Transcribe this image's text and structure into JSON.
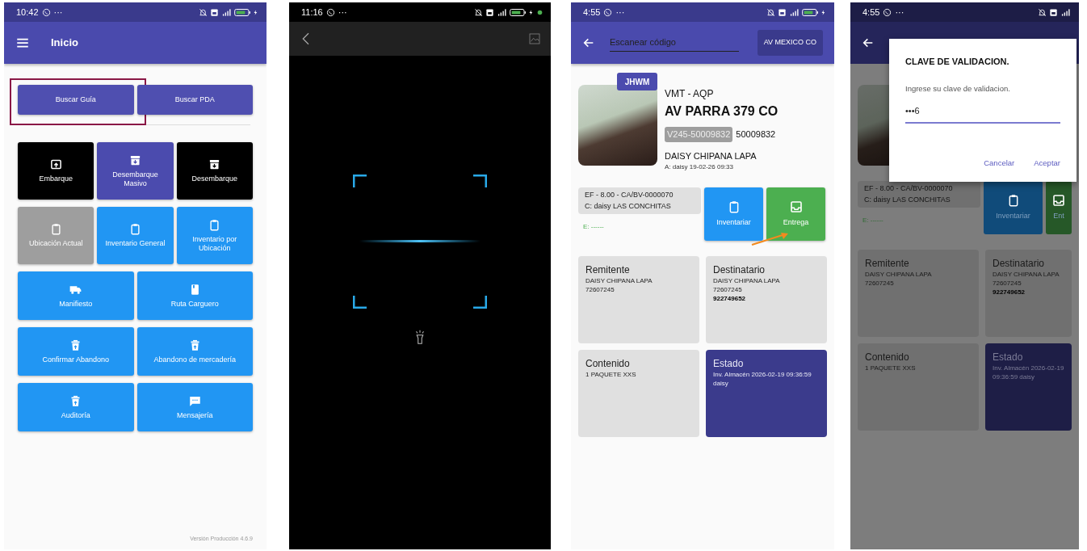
{
  "screens": [
    {
      "kind": "home",
      "status_bar": {
        "time": "10:42",
        "more": "···"
      },
      "app_bar": {
        "title": "Inicio"
      },
      "search_buttons": [
        {
          "label": "Buscar Guía",
          "highlighted": true
        },
        {
          "label": "Buscar PDA",
          "highlighted": false
        }
      ],
      "tile_rows": [
        {
          "tiles": [
            {
              "label": "Embarque",
              "kind": "tray-up",
              "color": "#000000"
            },
            {
              "label": "Desembarque Masivo",
              "kind": "box",
              "color": "#4b4bae"
            },
            {
              "label": "Desembarque",
              "kind": "box",
              "color": "#000000"
            }
          ]
        },
        {
          "tiles": [
            {
              "label": "Ubicación Actual",
              "kind": "clipboard",
              "color": "#9e9e9e"
            },
            {
              "label": "Inventario General",
              "kind": "clipboard",
              "color": "#2196f3"
            },
            {
              "label": "Inventario por Ubicación",
              "kind": "clipboard",
              "color": "#2196f3"
            }
          ]
        },
        {
          "tiles": [
            {
              "label": "Manifiesto",
              "kind": "truck",
              "color": "#2196f3"
            },
            {
              "label": "Ruta Carguero",
              "kind": "book",
              "color": "#2196f3"
            }
          ]
        },
        {
          "tiles": [
            {
              "label": "Confirmar Abandono",
              "kind": "trash",
              "color": "#2196f3"
            },
            {
              "label": "Abandono de mercadería",
              "kind": "trash",
              "color": "#2196f3"
            }
          ]
        },
        {
          "tiles": [
            {
              "label": "Auditoría",
              "kind": "trash",
              "color": "#2196f3"
            },
            {
              "label": "Mensajería",
              "kind": "chat",
              "color": "#2196f3"
            }
          ]
        }
      ],
      "version": "Versión Producción 4.6.9"
    },
    {
      "kind": "scanner",
      "status_bar": {
        "time": "11:16",
        "more": "···"
      }
    },
    {
      "kind": "detail",
      "status_bar": {
        "time": "4:55",
        "more": "···"
      },
      "header": {
        "search": {
          "placeholder": "Escanear código"
        },
        "branch_button": "AV MEXICO CO"
      },
      "detail": {
        "badge": "JHWM",
        "route": "VMT - AQP",
        "address": "AV PARRA 379 CO",
        "tracking_tag": "V245-50009832",
        "tracking_number": "50009832",
        "client": "DAISY CHIPANA LAPA",
        "created": "A: daisy 19-02-26 09:33",
        "payment_lines": [
          "EF - 8.00 - CA/BV-0000070",
          "C: daisy LAS CONCHITAS"
        ],
        "delivery_line": "E: ------",
        "actions": [
          {
            "label": "Inventariar",
            "kind": "clipboard",
            "color": "#2196f3"
          },
          {
            "label": "Entrega",
            "kind": "tray",
            "color": "#4caf50"
          }
        ],
        "cards": [
          {
            "title": "Remitente",
            "color": "#e0e0e0",
            "lines": [
              {
                "text": "DAISY CHIPANA LAPA",
                "bold": false
              },
              {
                "text": "72607245",
                "bold": false
              }
            ]
          },
          {
            "title": "Destinatario",
            "color": "#e0e0e0",
            "lines": [
              {
                "text": "DAISY CHIPANA LAPA",
                "bold": false
              },
              {
                "text": "72607245",
                "bold": false
              },
              {
                "text": "922749652",
                "bold": true
              }
            ]
          },
          {
            "title": "Contenido",
            "color": "#e0e0e0",
            "lines": [
              {
                "text": "1 PAQUETE XXS",
                "bold": false
              }
            ]
          },
          {
            "title": "Estado",
            "color": "#3b3b8c",
            "lines": [
              {
                "text": "Inv. Almacén  2026-02-19 09:36:59 daisy",
                "bold": false
              }
            ]
          }
        ]
      }
    },
    {
      "kind": "dialog",
      "status_bar": {
        "time": "4:55",
        "more": "···"
      },
      "detail": {
        "payment_lines": [
          "EF - 8.00 - CA/BV-0000070",
          "C: daisy LAS CONCHITAS"
        ],
        "delivery_line": "E: ------",
        "actions": [
          {
            "label": "Inventariar",
            "kind": "clipboard",
            "color": "#104b7a"
          },
          {
            "label": "Ent",
            "kind": "tray",
            "color": "#265828"
          }
        ],
        "cards": [
          {
            "title": "Remitente",
            "color": "#707070",
            "lines": [
              {
                "text": "DAISY CHIPANA LAPA",
                "bold": false
              },
              {
                "text": "72607245",
                "bold": false
              }
            ]
          },
          {
            "title": "Destinatario",
            "color": "#707070",
            "lines": [
              {
                "text": "DAISY CHIPANA LAPA",
                "bold": false
              },
              {
                "text": "72607245",
                "bold": false
              },
              {
                "text": "922749652",
                "bold": true
              }
            ]
          },
          {
            "title": "Contenido",
            "color": "#707070",
            "lines": [
              {
                "text": "1 PAQUETE XXS",
                "bold": false
              }
            ]
          },
          {
            "title": "Estado",
            "color": "#1e1e46",
            "lines": [
              {
                "text": "Inv. Almacén  2026-02-19 09:36:59 daisy",
                "bold": false
              }
            ]
          }
        ]
      },
      "dialog": {
        "title": "CLAVE DE VALIDACION.",
        "message": "Ingrese su clave de validacion.",
        "field": {
          "value": "•••6"
        },
        "buttons": [
          {
            "label": "Cancelar"
          },
          {
            "label": "Aceptar"
          }
        ]
      }
    }
  ]
}
